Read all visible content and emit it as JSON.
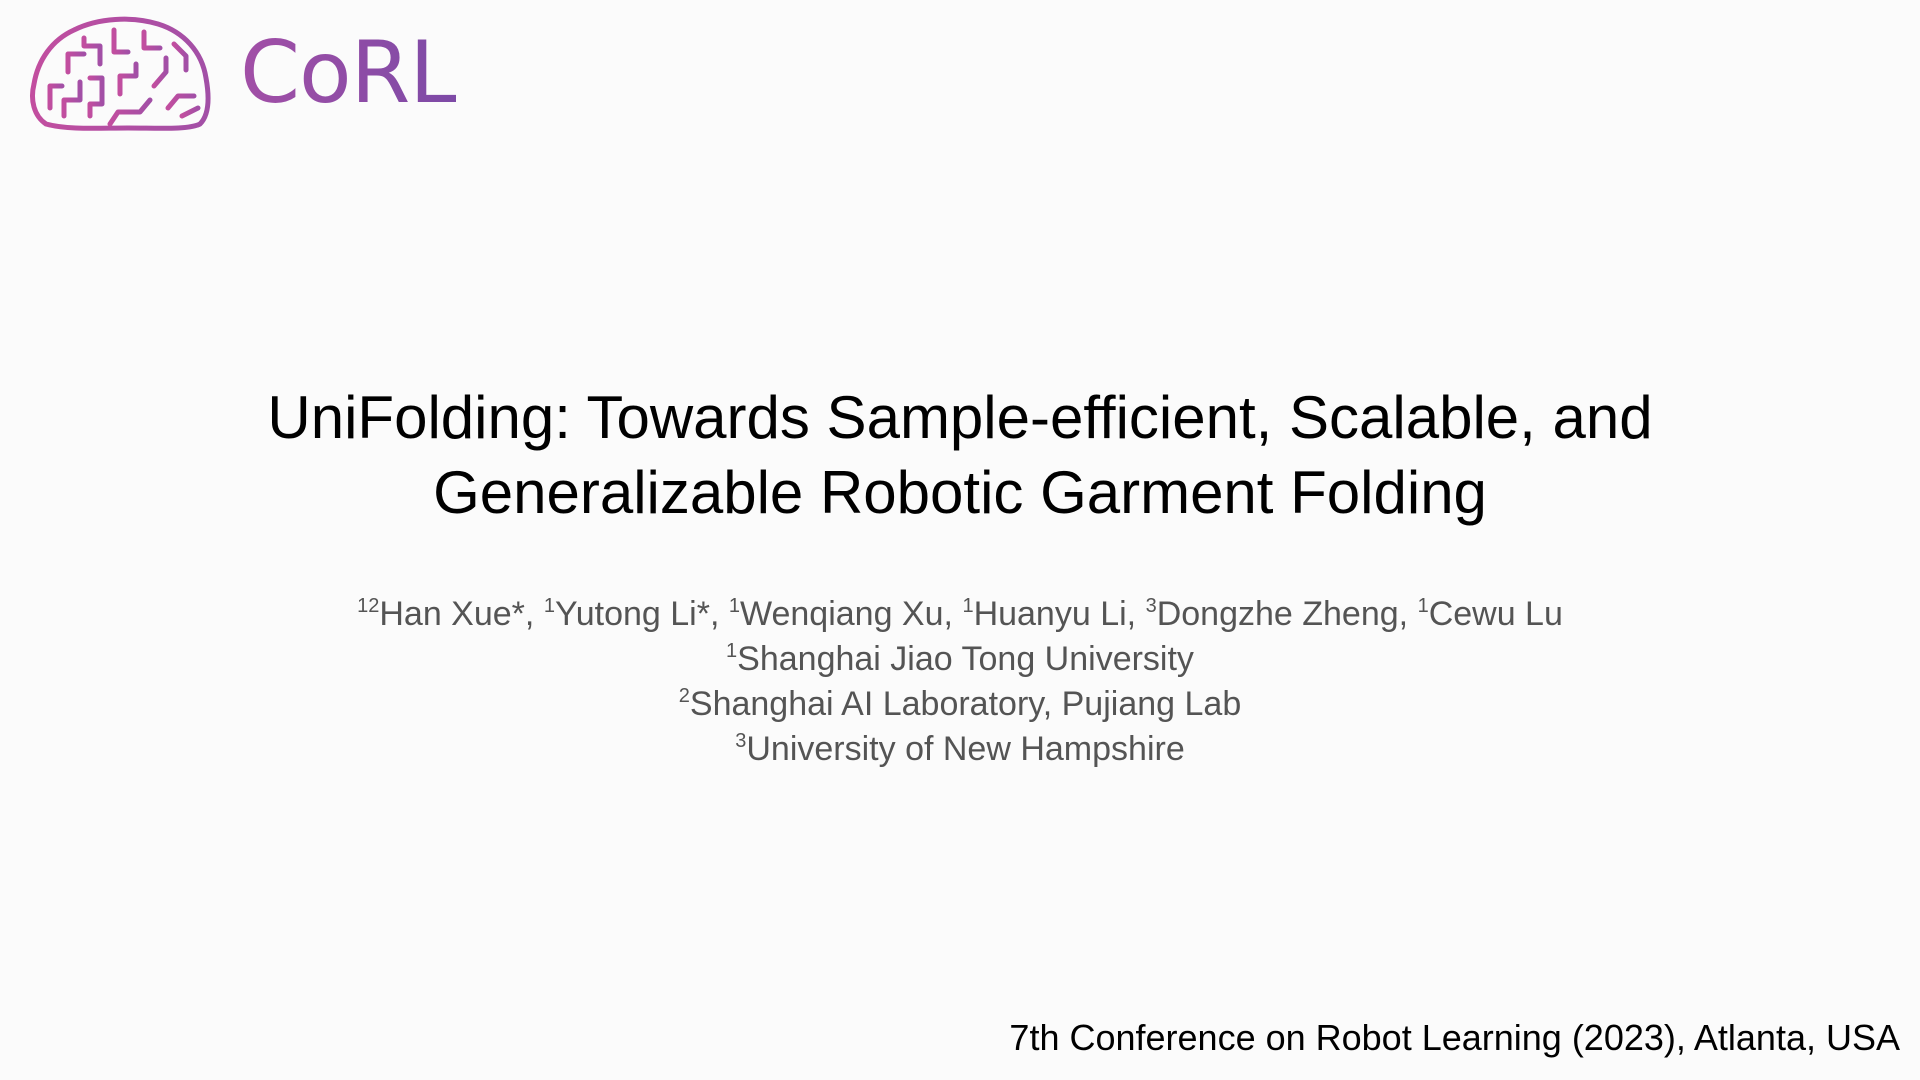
{
  "logo": {
    "icon": "brain-circuit-icon",
    "wordmark": "CoRL",
    "colors": {
      "magenta": "#c24e9f",
      "purple": "#7d4aa6"
    }
  },
  "title": {
    "line1": "UniFolding: Towards Sample-efficient, Scalable, and",
    "line2": "Generalizable Robotic Garment Folding"
  },
  "authors": [
    {
      "sup": "12",
      "name": "Han Xue*"
    },
    {
      "sup": "1",
      "name": "Yutong Li*"
    },
    {
      "sup": "1",
      "name": "Wenqiang Xu"
    },
    {
      "sup": "1",
      "name": "Huanyu Li"
    },
    {
      "sup": "3",
      "name": "Dongzhe Zheng"
    },
    {
      "sup": "1",
      "name": "Cewu Lu"
    }
  ],
  "affiliations": [
    {
      "sup": "1",
      "name": "Shanghai Jiao Tong University"
    },
    {
      "sup": "2",
      "name": "Shanghai AI Laboratory, Pujiang Lab"
    },
    {
      "sup": "3",
      "name": "University of New Hampshire"
    }
  ],
  "footer": {
    "venue": "7th Conference on Robot Learning (2023), Atlanta, USA"
  }
}
